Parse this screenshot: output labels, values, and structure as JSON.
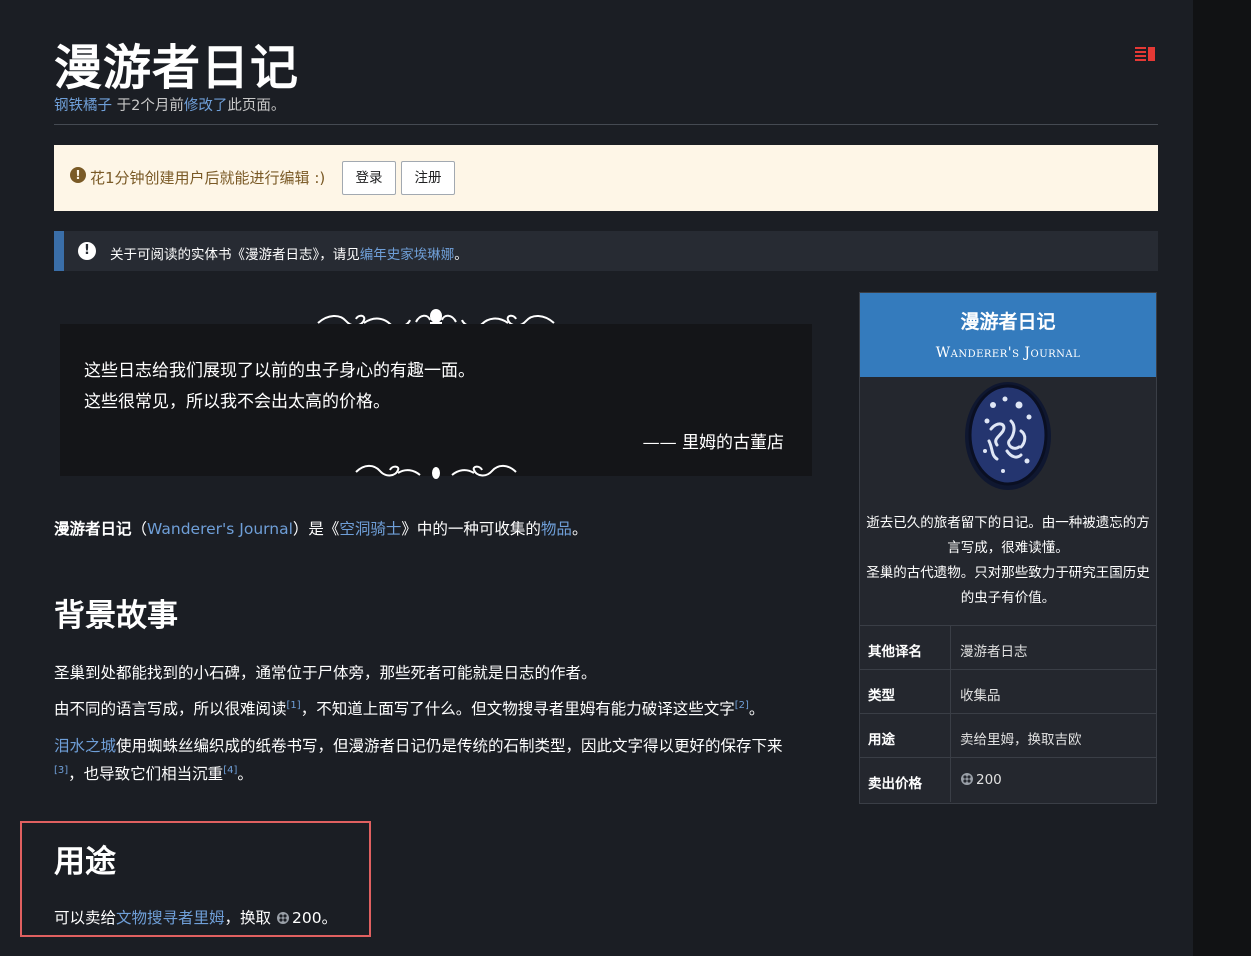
{
  "page": {
    "title": "漫游者日记",
    "editor": "钢铁橘子",
    "edited_prefix": " 于2个月前",
    "edited_link": "修改了",
    "edited_suffix": "此页面。"
  },
  "notice": {
    "text": "花1分钟创建用户后就能进行编辑 :)",
    "login_label": "登录",
    "register_label": "注册"
  },
  "hatnote": {
    "text_prefix": "关于可阅读的实体书《漫游者日志》，请见",
    "link": "编年史家埃琳娜",
    "text_suffix": "。"
  },
  "quote": {
    "line1": "这些日志给我们展现了以前的虫子身心的有趣一面。",
    "line2": "这些很常见，所以我不会出太高的价格。",
    "attribution": "—— 里姆的古董店"
  },
  "intro": {
    "name": "漫游者日记",
    "paren_open": "（",
    "english_name": "Wanderer's Journal",
    "mid": "）是《",
    "game_link": "空洞骑士",
    "mid2": "》中的一种可收集的",
    "item_link": "物品",
    "end": "。"
  },
  "lore": {
    "heading": "背景故事",
    "p1": "圣巢到处都能找到的小石碑，通常位于尸体旁，那些死者可能就是日志的作者。",
    "p2_a": "由不同的语言写成，所以很难阅读",
    "ref1": "[1]",
    "p2_b": "，不知道上面写了什么。但文物搜寻者里姆有能力破译这些文字",
    "ref2": "[2]",
    "p2_c": "。",
    "p3_link": "泪水之城",
    "p3_a": "使用蜘蛛丝编织成的纸卷书写，但漫游者日记仍是传统的石制类型，因此文字得以更好的保存下来",
    "ref3": "[3]",
    "p3_b": "，也导致它们相当沉重",
    "ref4": "[4]",
    "p3_c": "。"
  },
  "usage": {
    "heading": "用途",
    "text_a": "可以卖给",
    "link": "文物搜寻者里姆",
    "text_b": "，换取 ",
    "amount": "200",
    "text_c": "。"
  },
  "infobox": {
    "title": "漫游者日记",
    "subtitle": "Wanderer's Journal",
    "desc1": "逝去已久的旅者留下的日记。由一种被遗忘的方言写成，很难读懂。",
    "desc2": "圣巢的古代遗物。只对那些致力于研究王国历史的虫子有价值。",
    "rows": [
      {
        "label": "其他译名",
        "value": "漫游者日志"
      },
      {
        "label": "类型",
        "value": "收集品"
      },
      {
        "label": "用途",
        "value": "卖给里姆，换取吉欧"
      },
      {
        "label": "卖出价格",
        "value": "200"
      }
    ]
  },
  "icons": {
    "toc": "toc-icon",
    "notice": "exclamation-circle-icon",
    "hatnote": "info-circle-icon",
    "currency": "geo-icon"
  },
  "colors": {
    "link": "#6f9fd8",
    "infobox_header": "#347bbd",
    "notice_bg": "#fef6e7",
    "highlight": "#e06060"
  }
}
